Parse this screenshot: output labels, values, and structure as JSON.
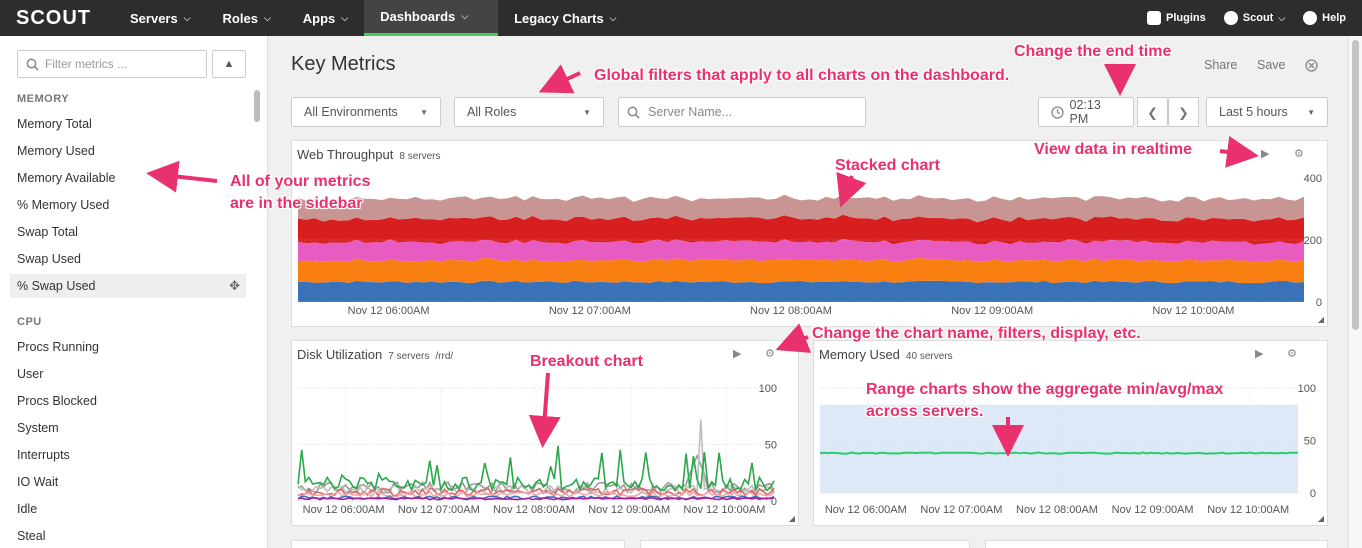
{
  "nav": {
    "logo": "SCOUT",
    "items": [
      {
        "label": "Servers"
      },
      {
        "label": "Roles"
      },
      {
        "label": "Apps"
      },
      {
        "label": "Dashboards",
        "active": true
      },
      {
        "label": "Legacy Charts"
      }
    ],
    "plugins": "Plugins",
    "account": "Scout",
    "help": "Help"
  },
  "sidebar": {
    "filter_placeholder": "Filter metrics ...",
    "memory_header": "MEMORY",
    "memory_items": [
      "Memory Total",
      "Memory Used",
      "Memory Available",
      "% Memory Used",
      "Swap Total",
      "Swap Used",
      "% Swap Used"
    ],
    "cpu_header": "CPU",
    "cpu_items": [
      "Procs Running",
      "User",
      "Procs Blocked",
      "System",
      "Interrupts",
      "IO Wait",
      "Idle",
      "Steal"
    ]
  },
  "dashboard": {
    "title": "Key Metrics",
    "share": "Share",
    "save": "Save",
    "env_filter": "All Environments",
    "role_filter": "All Roles",
    "server_placeholder": "Server Name...",
    "end_time": "02:13 PM",
    "range": "Last 5 hours"
  },
  "charts": {
    "web": {
      "title": "Web Throughput",
      "sub": "8 servers"
    },
    "disk": {
      "title": "Disk Utilization",
      "sub": "7 servers",
      "path": "/rrd/"
    },
    "mem": {
      "title": "Memory Used",
      "sub": "40 servers"
    }
  },
  "chart_data": [
    {
      "type": "area",
      "title": "Web Throughput",
      "stacked": true,
      "x": [
        "Nov 12 06:00AM",
        "Nov 12 07:00AM",
        "Nov 12 08:00AM",
        "Nov 12 09:00AM",
        "Nov 12 10:00AM"
      ],
      "yticks": [
        0,
        200,
        400
      ],
      "ylim": [
        0,
        400
      ],
      "series": [
        {
          "color": "#3a72b9",
          "values": [
            65,
            65,
            65,
            65,
            65
          ]
        },
        {
          "color": "#fa7f13",
          "values": [
            70,
            70,
            70,
            70,
            70
          ]
        },
        {
          "color": "#e85bc0",
          "values": [
            60,
            60,
            60,
            60,
            60
          ]
        },
        {
          "color": "#d81f1f",
          "values": [
            75,
            75,
            75,
            75,
            75
          ]
        },
        {
          "color": "#c89592",
          "values": [
            65,
            65,
            65,
            65,
            65
          ]
        }
      ]
    },
    {
      "type": "line",
      "title": "Disk Utilization",
      "x": [
        "Nov 12 06:00AM",
        "Nov 12 07:00AM",
        "Nov 12 08:00AM",
        "Nov 12 09:00AM",
        "Nov 12 10:00AM"
      ],
      "yticks": [
        0,
        50,
        100
      ],
      "ylim": [
        0,
        100
      ]
    },
    {
      "type": "area",
      "title": "Memory Used",
      "range": true,
      "x": [
        "Nov 12 06:00AM",
        "Nov 12 07:00AM",
        "Nov 12 08:00AM",
        "Nov 12 09:00AM",
        "Nov 12 10:00AM"
      ],
      "yticks": [
        0,
        50,
        100
      ],
      "ylim": [
        0,
        100
      ],
      "min": 0,
      "avg": 38,
      "max": 84
    }
  ],
  "annotations": {
    "end_time": "Change the end time",
    "filters": "Global filters that apply to all charts on the dashboard.",
    "realtime": "View data in realtime",
    "stacked": "Stacked chart",
    "sidebar_1": "All of your metrics",
    "sidebar_2": "are in the sidebar",
    "chart_name": "Change the chart name, filters, display, etc.",
    "breakout": "Breakout chart",
    "range_1": "Range charts show the aggregate min/avg/max",
    "range_2": "across servers."
  },
  "colors": {
    "annotation": "#e8316d",
    "nav_bg": "#2d2d2d",
    "active": "#3ccf5a"
  }
}
